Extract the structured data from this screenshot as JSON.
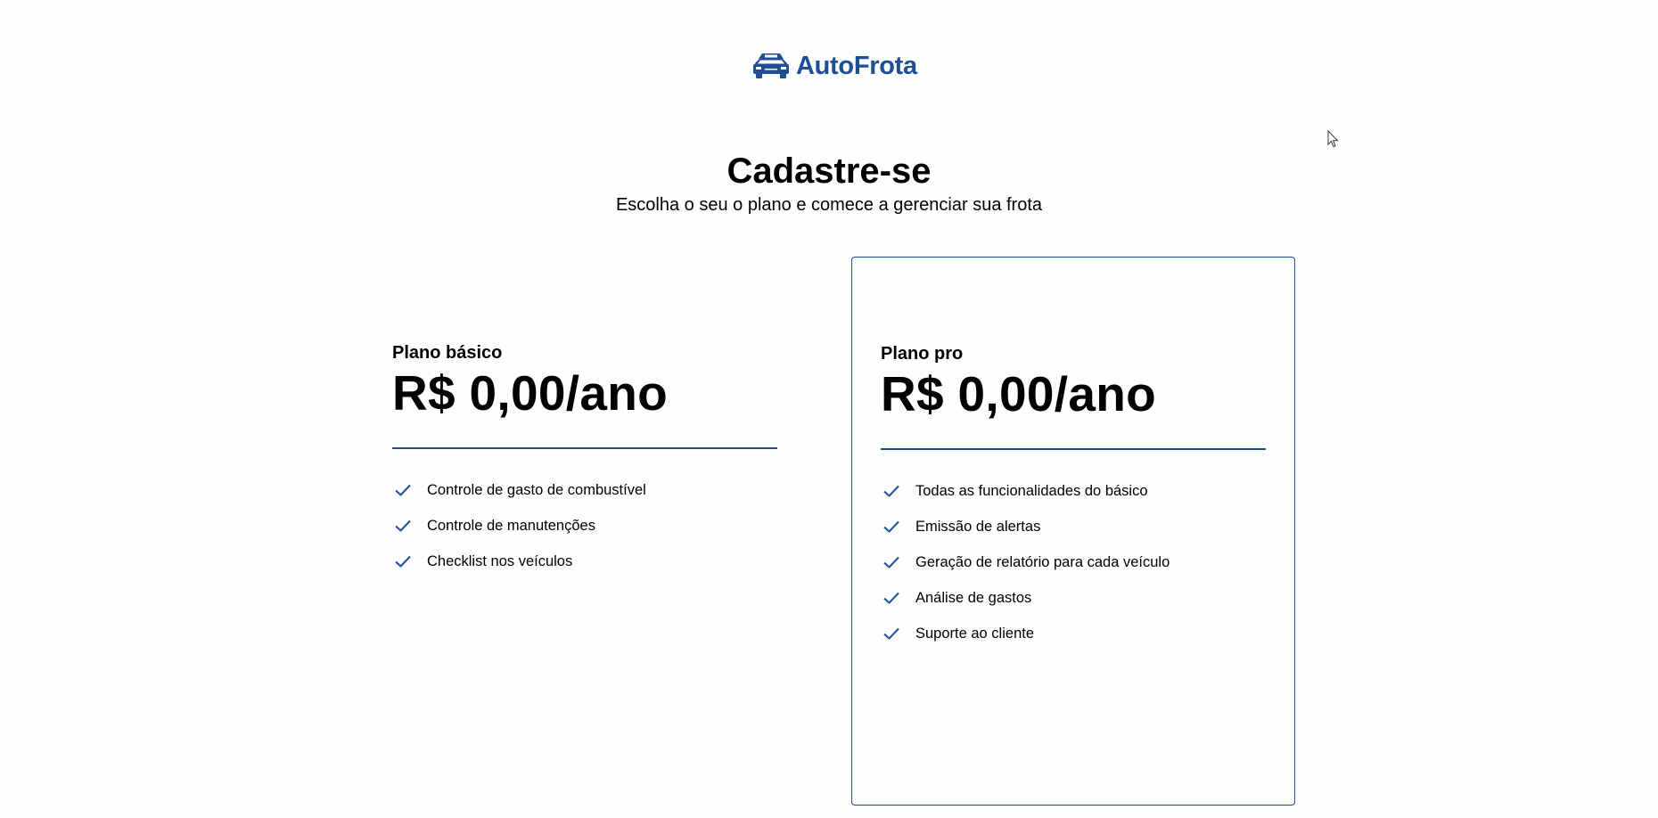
{
  "brand": {
    "name": "AutoFrota",
    "icon": "car-fleet-icon",
    "color": "#1f4e93"
  },
  "header": {
    "title": "Cadastre-se",
    "subtitle": "Escolha o seu o plano e comece a gerenciar sua frota"
  },
  "plans": [
    {
      "name": "Plano básico",
      "price": "R$ 0,00/ano",
      "highlighted": false,
      "features": [
        "Controle de gasto de combustível",
        "Controle de manutenções",
        "Checklist nos veículos"
      ]
    },
    {
      "name": "Plano pro",
      "price": "R$ 0,00/ano",
      "highlighted": true,
      "features": [
        "Todas as funcionalidades do básico",
        "Emissão de alertas",
        "Geração de relatório para cada veículo",
        "Análise de gastos",
        "Suporte ao cliente"
      ]
    }
  ],
  "colors": {
    "accent": "#1f4e93",
    "background": "#fdfefe"
  }
}
